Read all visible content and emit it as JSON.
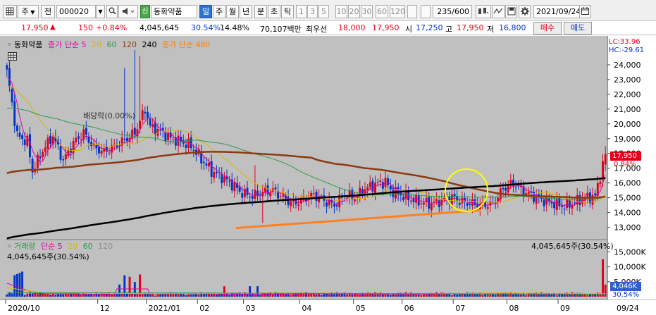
{
  "toolbar": {
    "mode_select": "주",
    "market_button": "전",
    "code": "000020",
    "new_badge": "신",
    "stock_name": "동화약품",
    "period_tabs": [
      "일",
      "주",
      "월",
      "년"
    ],
    "minute_tabs": [
      "분",
      "초",
      "틱"
    ],
    "interval_tabs": [
      "1",
      "3",
      "5",
      "10",
      "20",
      "30",
      "60",
      "120"
    ],
    "active_period": "일",
    "count": "235/600",
    "date": "2021/09/24"
  },
  "price_bar": {
    "price": "17,950",
    "change": "150",
    "change_pct": "+0.84%",
    "volume": "4,045,645",
    "volume_pct": "30.54%",
    "turnover_pct": "14.48%",
    "amount": "70,107백만",
    "priority_label": "최우선",
    "ask": "18,000",
    "bid": "17,950",
    "open_label": "시",
    "open": "17,250",
    "high_label": "고",
    "high": "17,950",
    "low_label": "저",
    "low": "16,800",
    "buy_button": "매수",
    "sell_button": "매도"
  },
  "price_legend": {
    "name": "동화약품",
    "ma_label": "종가 단순 5",
    "ma_periods": [
      "20",
      "60",
      "120",
      "240"
    ],
    "long_ma_label": "종가 단순 480",
    "lc": "LC:33.96",
    "hc": "HC:-29.61",
    "dividend": "배당락(0.00%)",
    "last_price": "17,950",
    "last_pct": "0.84%"
  },
  "volume_legend": {
    "title": "거래량",
    "ma_label": "단순 5",
    "ma_periods": [
      "20",
      "60",
      "120"
    ],
    "right_info": "4,045,645주(30.54%)",
    "left_info": "4,045,645주(30.54%)",
    "last_value": "4,046K",
    "last_pct": "30.54%"
  },
  "x_axis": [
    "2020/10",
    "12",
    "2021/01",
    "02",
    "03",
    "04",
    "05",
    "06",
    "07",
    "08",
    "09",
    "09/24"
  ],
  "colors": {
    "up": "#e0001a",
    "down": "#0032c8",
    "ma5": "#e000a0",
    "ma20": "#d8b800",
    "ma60": "#2e9a4a",
    "ma120": "#8b3a10",
    "ma240": "#000000",
    "ma480": "#ff8000",
    "trendline": "#ff8020",
    "highlight": "#ffff00"
  },
  "chart_data": {
    "type": "candlestick",
    "title": "",
    "y_ticks": [
      "24,000",
      "23,000",
      "22,000",
      "21,000",
      "20,000",
      "19,000",
      "18,000",
      "17,000",
      "16,000",
      "15,000",
      "14,000",
      "13,000"
    ],
    "ylim": [
      12500,
      25000
    ],
    "volume_ticks": [
      "15,000K",
      "10,000K",
      "5,000K"
    ],
    "volume_ylim": [
      0,
      17000
    ],
    "anchors_close": [
      [
        0,
        23500
      ],
      [
        4,
        19200
      ],
      [
        8,
        18800
      ],
      [
        10,
        16800
      ],
      [
        14,
        18200
      ],
      [
        18,
        19200
      ],
      [
        22,
        17500
      ],
      [
        26,
        18700
      ],
      [
        30,
        19400
      ],
      [
        34,
        18400
      ],
      [
        38,
        18100
      ],
      [
        42,
        18500
      ],
      [
        46,
        18900
      ],
      [
        50,
        19400
      ],
      [
        54,
        21000
      ],
      [
        56,
        19800
      ],
      [
        60,
        19500
      ],
      [
        64,
        19000
      ],
      [
        68,
        18800
      ],
      [
        72,
        18500
      ],
      [
        76,
        17600
      ],
      [
        80,
        16800
      ],
      [
        84,
        16400
      ],
      [
        88,
        15900
      ],
      [
        92,
        15300
      ],
      [
        96,
        15100
      ],
      [
        100,
        15400
      ],
      [
        104,
        15500
      ],
      [
        108,
        15000
      ],
      [
        112,
        14600
      ],
      [
        116,
        14900
      ],
      [
        120,
        15200
      ],
      [
        124,
        14800
      ],
      [
        128,
        14500
      ],
      [
        132,
        15200
      ],
      [
        136,
        15000
      ],
      [
        140,
        15600
      ],
      [
        144,
        15900
      ],
      [
        148,
        16100
      ],
      [
        150,
        15500
      ],
      [
        154,
        15200
      ],
      [
        158,
        14900
      ],
      [
        162,
        14700
      ],
      [
        166,
        14600
      ],
      [
        170,
        14800
      ],
      [
        174,
        15000
      ],
      [
        178,
        14700
      ],
      [
        182,
        14600
      ],
      [
        186,
        14500
      ],
      [
        190,
        14600
      ],
      [
        194,
        15600
      ],
      [
        198,
        16000
      ],
      [
        202,
        15400
      ],
      [
        206,
        15100
      ],
      [
        210,
        14800
      ],
      [
        214,
        14600
      ],
      [
        218,
        14400
      ],
      [
        222,
        14700
      ],
      [
        226,
        15000
      ],
      [
        230,
        15100
      ],
      [
        234,
        17950
      ]
    ],
    "ma480_start": 12950,
    "ma480_end": 14150
  }
}
